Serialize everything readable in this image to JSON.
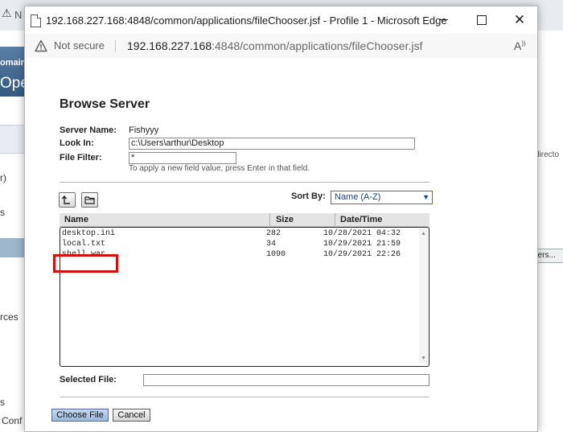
{
  "background": {
    "top_fragment": "N",
    "banner_line1": "omain",
    "banner_line2": "Ope",
    "nav_fragments": [
      "r)",
      "s",
      "rces",
      "s",
      "Conf"
    ],
    "right_fragment": "directo",
    "right_button_fragment": "ders..."
  },
  "window": {
    "title": "192.168.227.168:4848/common/applications/fileChooser.jsf - Profile 1 - Microsoft Edge",
    "min_icon": "minimize-icon",
    "max_icon": "maximize-icon",
    "close_glyph": "✕"
  },
  "address": {
    "security_label": "Not secure",
    "url_host": "192.168.227.168",
    "url_rest": ":4848/common/applications/fileChooser.jsf",
    "read_aloud_glyph": "Aₑ"
  },
  "page": {
    "heading": "Browse Server",
    "server_name_label": "Server Name:",
    "server_name_value": "Fishyyy",
    "look_in_label": "Look In:",
    "look_in_value": "c:\\Users\\arthur\\Desktop",
    "file_filter_label": "File Filter:",
    "file_filter_value": "*",
    "hint": "To apply a new field value, press Enter in that field.",
    "up_icon": "up-folder-icon",
    "new_folder_icon": "folder-icon",
    "sort_label": "Sort By:",
    "sort_value": "Name (A-Z)",
    "columns": {
      "name": "Name",
      "size": "Size",
      "date": "Date/Time"
    },
    "files": [
      {
        "name": "desktop.ini",
        "size": "282",
        "date": "10/28/2021 04:32"
      },
      {
        "name": "local.txt",
        "size": "34",
        "date": "10/29/2021 21:59"
      },
      {
        "name": "shell.war",
        "size": "1090",
        "date": "10/29/2021 22:26"
      }
    ],
    "selected_file_label": "Selected File:",
    "selected_file_value": "",
    "choose_button": "Choose File",
    "cancel_button": "Cancel"
  },
  "colors": {
    "highlight": "#d41111",
    "sort_text": "#1a3f7a",
    "primary_button": "#9fb9d9"
  }
}
